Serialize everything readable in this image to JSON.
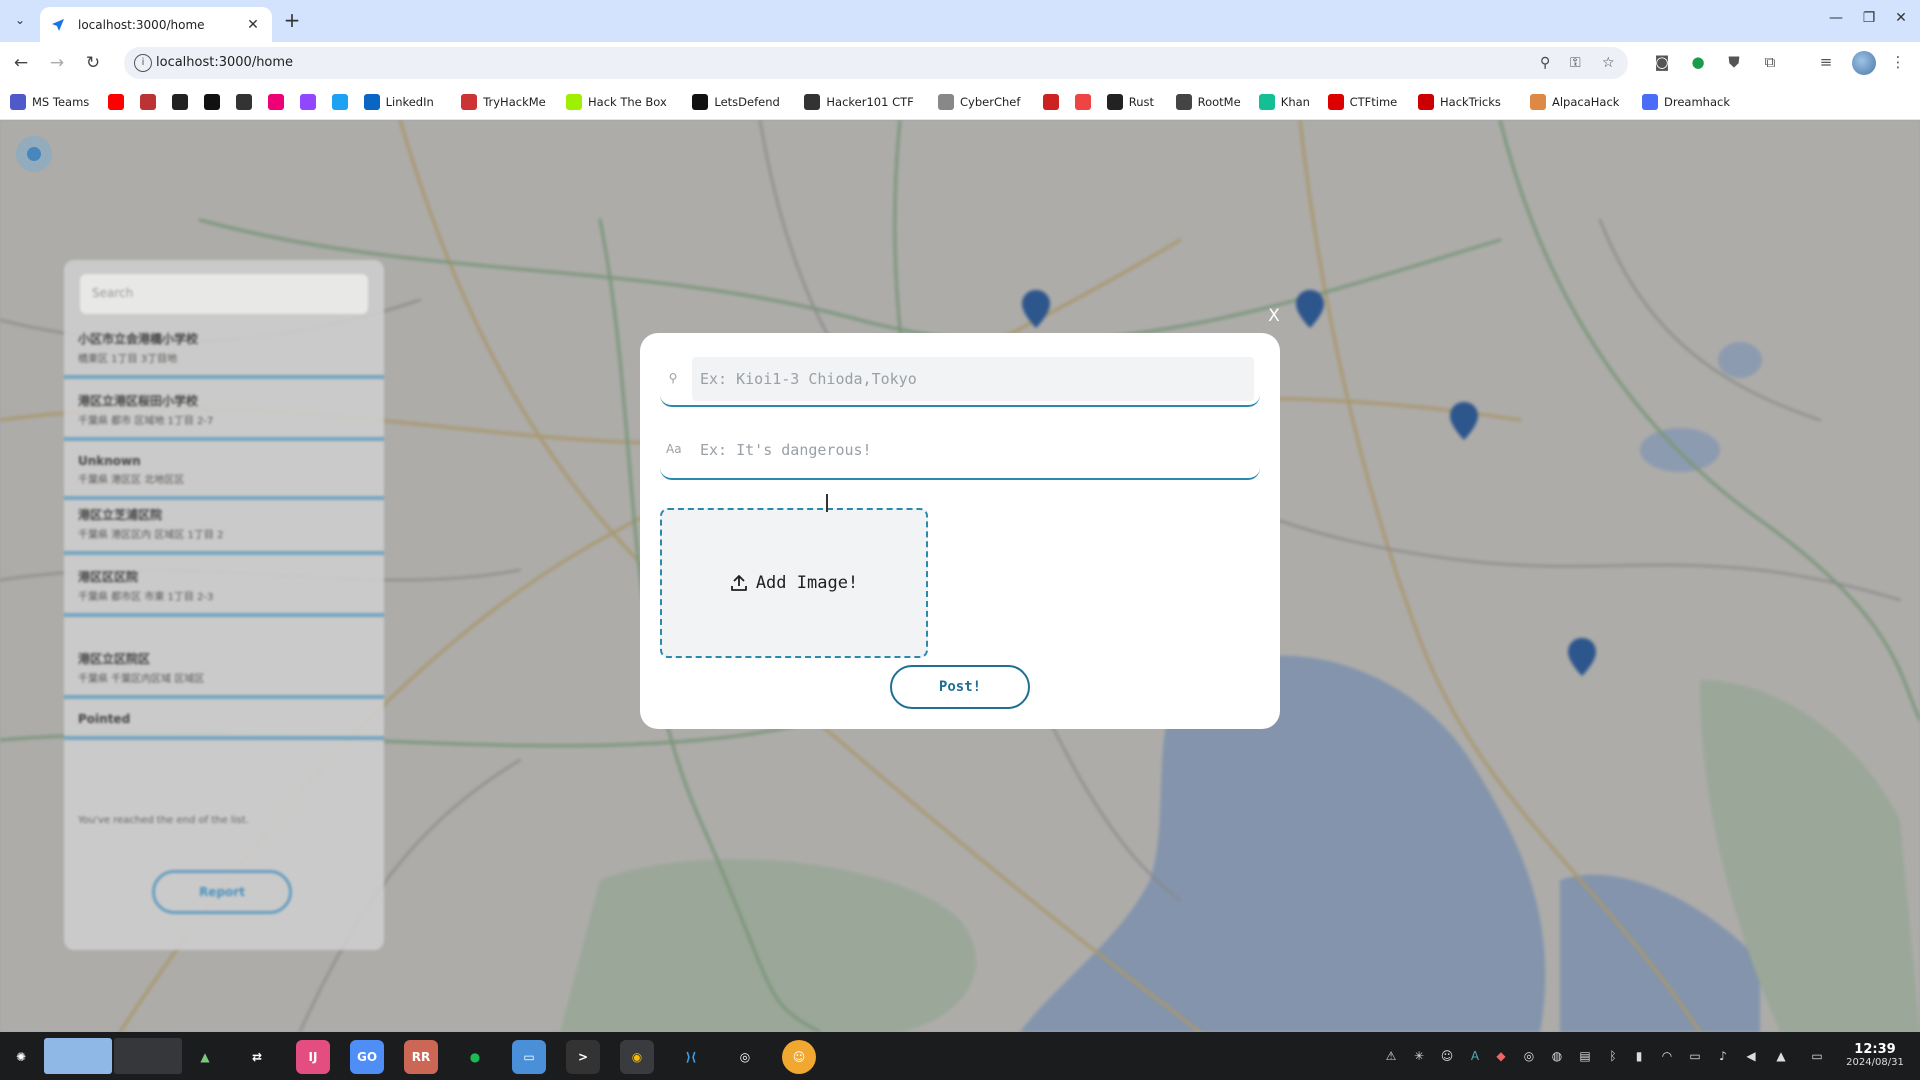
{
  "browser": {
    "tab_title": "localhost:3000/home",
    "url": "localhost:3000/home",
    "new_tab": "+",
    "tab_close": "✕"
  },
  "bookmarks": [
    {
      "label": "MS Teams",
      "icon": "teams-icon",
      "color": "#5059c9"
    },
    {
      "label": "",
      "icon": "youtube-icon",
      "color": "#ff0000"
    },
    {
      "label": "",
      "icon": "news-icon",
      "color": "#b33"
    },
    {
      "label": "",
      "icon": "notion-icon",
      "color": "#222"
    },
    {
      "label": "",
      "icon": "github-icon",
      "color": "#111"
    },
    {
      "label": "",
      "icon": "openai-icon",
      "color": "#333"
    },
    {
      "label": "",
      "icon": "gemini-icon",
      "color": "#e07"
    },
    {
      "label": "",
      "icon": "twitch-icon",
      "color": "#9146ff"
    },
    {
      "label": "",
      "icon": "site-icon",
      "color": "#1da1f2"
    },
    {
      "label": "LinkedIn",
      "icon": "linkedin-icon",
      "color": "#0a66c2"
    },
    {
      "label": "TryHackMe",
      "icon": "tryhackme-icon",
      "color": "#c33"
    },
    {
      "label": "Hack The Box",
      "icon": "hackthebox-icon",
      "color": "#9fef00"
    },
    {
      "label": "LetsDefend",
      "icon": "letsdefend-icon",
      "color": "#111"
    },
    {
      "label": "Hacker101 CTF",
      "icon": "hacker101-icon",
      "color": "#333"
    },
    {
      "label": "CyberChef",
      "icon": "cyberchef-icon",
      "color": "#888"
    },
    {
      "label": "",
      "icon": "grid-icon",
      "color": "#c22"
    },
    {
      "label": "",
      "icon": "p-icon",
      "color": "#e44"
    },
    {
      "label": "Rust",
      "icon": "rust-icon",
      "color": "#222"
    },
    {
      "label": "RootMe",
      "icon": "rootme-icon",
      "color": "#444"
    },
    {
      "label": "Khan",
      "icon": "khan-icon",
      "color": "#14bf96"
    },
    {
      "label": "CTFtime",
      "icon": "ctftime-icon",
      "color": "#d00"
    },
    {
      "label": "HackTricks",
      "icon": "hacktricks-icon",
      "color": "#c00"
    },
    {
      "label": "AlpacaHack",
      "icon": "alpacahack-icon",
      "color": "#d84"
    },
    {
      "label": "Dreamhack",
      "icon": "dreamhack-icon",
      "color": "#4a6cf7"
    }
  ],
  "sidepanel": {
    "search_placeholder": "Search",
    "items": [
      {
        "l1": "小区市立会港橋小学校",
        "l2": "橋東区 1丁目 3丁目地"
      },
      {
        "l1": "港区立港区桜田小学校",
        "l2": "千葉県 都市 区域地 1丁目 2-7"
      },
      {
        "l1": "Unknown",
        "l2": "千葉県 港区区 北地区区"
      },
      {
        "l1": "港区立芝浦区院",
        "l2": "千葉県 港区区内 区域区 1丁目 2"
      },
      {
        "l1": "港区区区院",
        "l2": "千葉県 都市区 市東 1丁目 2-3"
      },
      {
        "l1": "港区立区院区",
        "l2": "千葉県 千葉区内区域 区域区"
      },
      {
        "l1": "Pointed",
        "l2": ""
      }
    ],
    "note": "You've reached the end of the list.",
    "button": "Report"
  },
  "modal": {
    "close": "X",
    "address_placeholder": "Ex: Kioi1-3 Chioda,Tokyo",
    "address_icon": "pin-icon",
    "comment_icon_label": "Aa",
    "comment_placeholder": "Ex: It's dangerous!",
    "add_image_label": "Add Image!",
    "post_label": "Post!"
  },
  "taskbar": {
    "time": "12:39",
    "date": "2024/08/31"
  },
  "colors": {
    "accent": "#2a8aae",
    "post": "#1f6f94",
    "tabstrip": "#d3e3fd",
    "taskbar": "#1b1c1e"
  }
}
